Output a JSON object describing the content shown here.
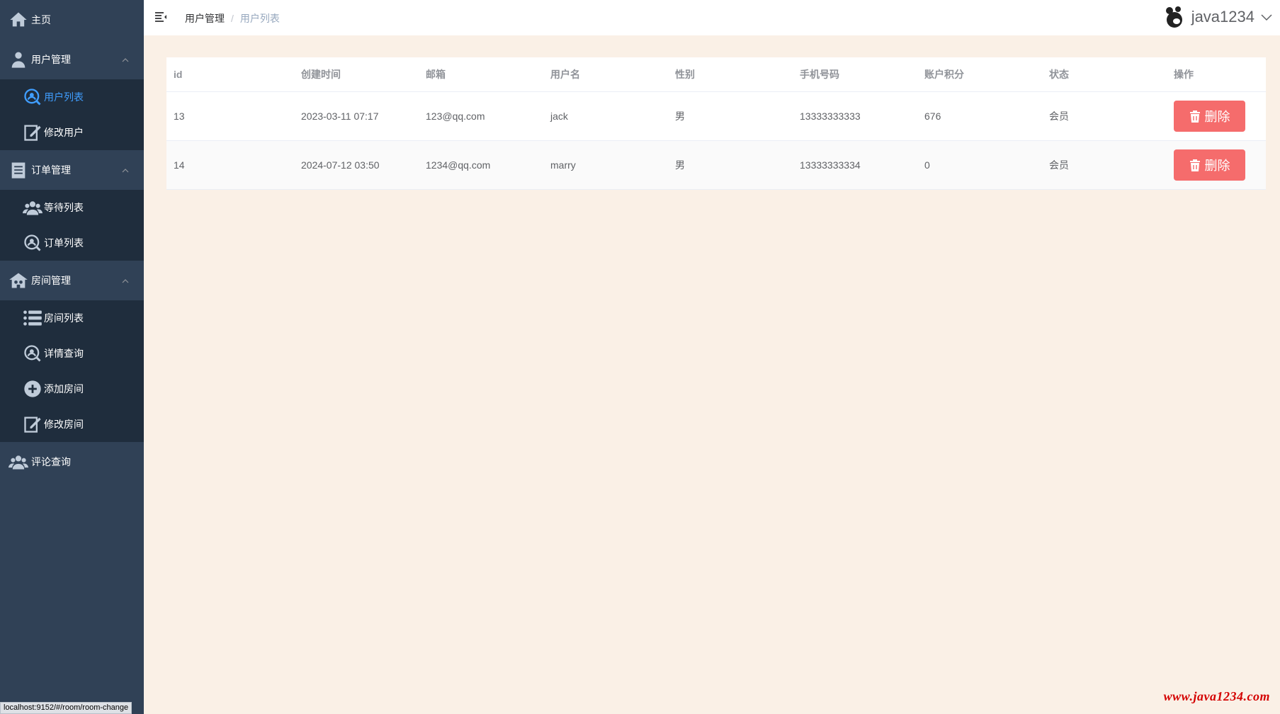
{
  "sidebar": {
    "home": {
      "label": "主页",
      "icon": "home-icon"
    },
    "groups": [
      {
        "label": "用户管理",
        "icon": "user-icon",
        "items": [
          {
            "label": "用户列表",
            "icon": "search-user-icon",
            "active": true
          },
          {
            "label": "修改用户",
            "icon": "edit-icon"
          }
        ]
      },
      {
        "label": "订单管理",
        "icon": "document-icon",
        "items": [
          {
            "label": "等待列表",
            "icon": "group-icon"
          },
          {
            "label": "订单列表",
            "icon": "search-icon"
          }
        ]
      },
      {
        "label": "房间管理",
        "icon": "building-icon",
        "items": [
          {
            "label": "房间列表",
            "icon": "list-icon"
          },
          {
            "label": "详情查询",
            "icon": "search-icon"
          },
          {
            "label": "添加房间",
            "icon": "add-icon"
          },
          {
            "label": "修改房间",
            "icon": "edit-icon"
          }
        ]
      }
    ],
    "comment": {
      "label": "评论查询",
      "icon": "group-icon"
    }
  },
  "header": {
    "breadcrumb": {
      "parent": "用户管理",
      "separator": "/",
      "current": "用户列表"
    },
    "username": "java1234"
  },
  "table": {
    "columns": [
      "id",
      "创建时间",
      "邮箱",
      "用户名",
      "性别",
      "手机号码",
      "账户积分",
      "状态",
      "操作"
    ],
    "rows": [
      {
        "id": "13",
        "created": "2023-03-11 07:17",
        "email": "123@qq.com",
        "username": "jack",
        "gender": "男",
        "phone": "13333333333",
        "points": "676",
        "status": "会员",
        "action": "删除"
      },
      {
        "id": "14",
        "created": "2024-07-12 03:50",
        "email": "1234@qq.com",
        "username": "marry",
        "gender": "男",
        "phone": "13333333334",
        "points": "0",
        "status": "会员",
        "action": "删除"
      }
    ]
  },
  "statusbar": {
    "url": "localhost:9152/#/room/room-change"
  },
  "watermark": "www.java1234.com",
  "colors": {
    "sidebar": "#304156",
    "submenu": "#1f2d3d",
    "active": "#409eff",
    "danger": "#f56c6c",
    "page_bg": "#faf0e6"
  }
}
